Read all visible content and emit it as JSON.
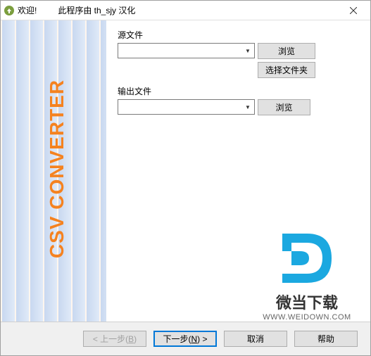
{
  "titlebar": {
    "welcome": "欢迎!",
    "subtitle": "此程序由 th_sjy 汉化"
  },
  "sidebar": {
    "title": "CSV CONVERTER"
  },
  "main": {
    "source_label": "源文件",
    "source_value": "",
    "browse_label": "浏览",
    "select_folder_label": "选择文件夹",
    "output_label": "输出文件",
    "output_value": "",
    "output_browse_label": "浏览"
  },
  "footer": {
    "back_label_prefix": "< 上一步(",
    "back_key": "B",
    "back_label_suffix": ")",
    "next_label_prefix": "下一步(",
    "next_key": "N",
    "next_label_suffix": ") >",
    "cancel_label": "取消",
    "help_label": "帮助"
  },
  "watermark": {
    "text": "微当下载",
    "url": "WWW.WEIDOWN.COM"
  }
}
